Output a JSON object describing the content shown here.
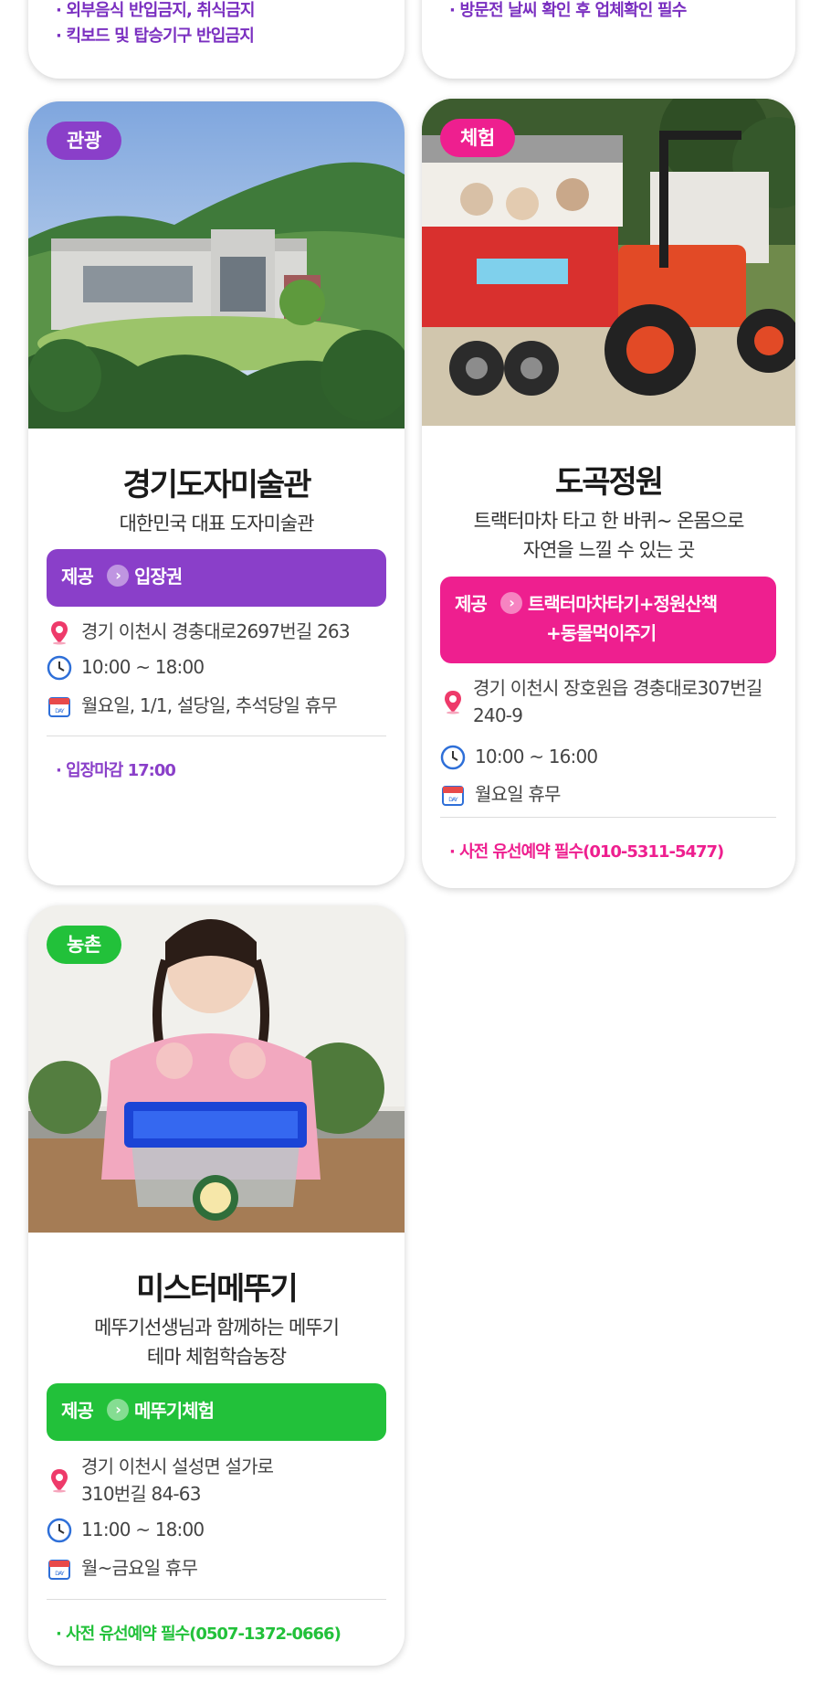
{
  "colors": {
    "purple": "#8a3fc9",
    "pink": "#ee1f8f",
    "green": "#22c13a"
  },
  "top_notes": {
    "left": [
      "· 외부음식 반입금지, 취식금지",
      "· 킥보드 및 탑승기구 반입금지"
    ],
    "right": [
      "· 방문전 날씨 확인 후 업체확인 필수"
    ]
  },
  "cards": [
    {
      "badge": "관광",
      "title": "경기도자미술관",
      "desc": [
        "대한민국 대표 도자미술관"
      ],
      "provide_label": "제공",
      "provide_value": [
        "입장권"
      ],
      "address": [
        "경기 이천시 경충대로2697번길 263"
      ],
      "hours": "10:00 ~ 18:00",
      "closed": "월요일, 1/1, 설당일, 추석당일 휴무",
      "note": "· 입장마감 17:00",
      "icons": [
        "map-pin-icon",
        "clock-icon",
        "calendar-icon"
      ]
    },
    {
      "badge": "체험",
      "title": "도곡정원",
      "desc": [
        "트랙터마차 타고 한 바퀴~ 온몸으로",
        "자연을 느낄 수 있는 곳"
      ],
      "provide_label": "제공",
      "provide_value": [
        "트랙터마차타기+정원산책",
        "+동물먹이주기"
      ],
      "address": [
        "경기 이천시 장호원읍 경충대로307번길",
        "240-9"
      ],
      "hours": "10:00 ~ 16:00",
      "closed": "월요일 휴무",
      "note": "· 사전 유선예약 필수(010-5311-5477)",
      "icons": [
        "map-pin-icon",
        "clock-icon",
        "calendar-icon"
      ]
    },
    {
      "badge": "농촌",
      "title": "미스터메뚜기",
      "desc": [
        "메뚜기선생님과 함께하는 메뚜기",
        "테마 체험학습농장"
      ],
      "provide_label": "제공",
      "provide_value": [
        "메뚜기체험"
      ],
      "address": [
        "경기 이천시 설성면 설가로",
        "310번길 84-63"
      ],
      "hours": "11:00 ~ 18:00",
      "closed": "월~금요일 휴무",
      "note": "· 사전 유선예약 필수(0507-1372-0666)",
      "icons": [
        "map-pin-icon",
        "clock-icon",
        "calendar-icon"
      ]
    }
  ]
}
